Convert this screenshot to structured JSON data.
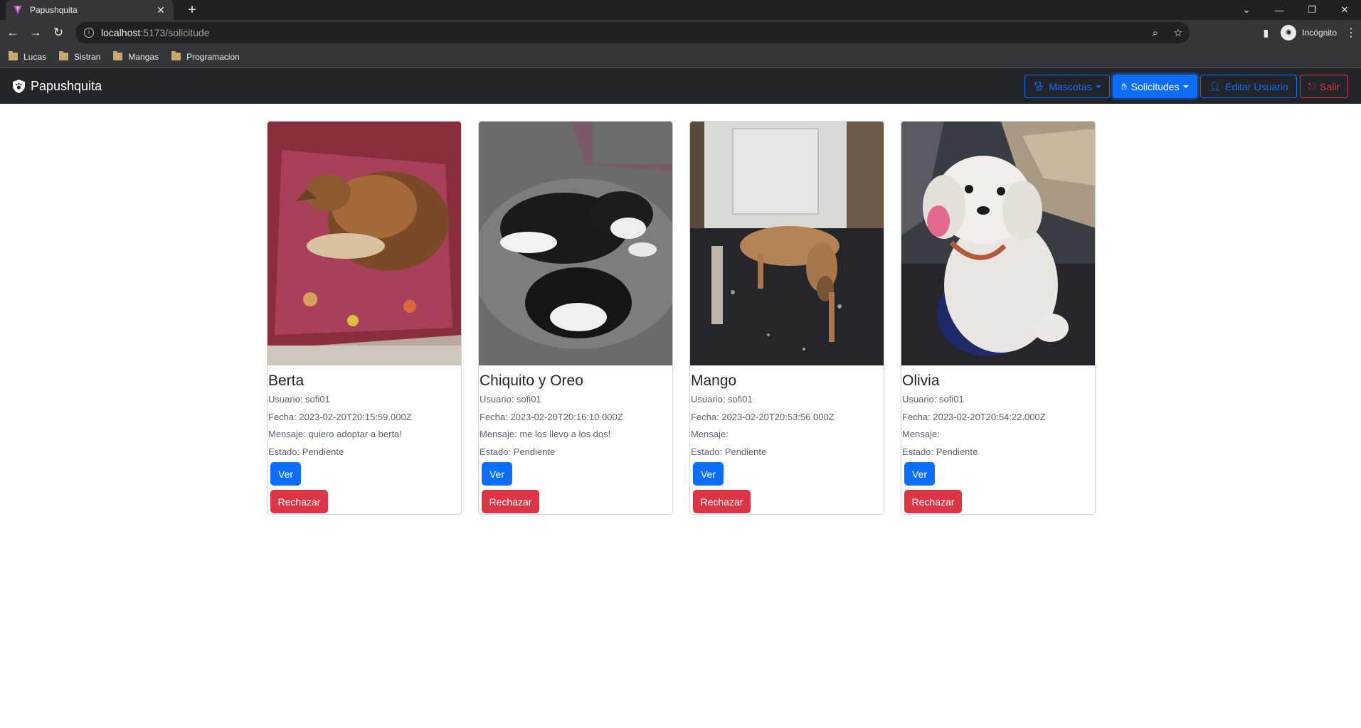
{
  "browser": {
    "tab_title": "Papushquita",
    "url_host": "localhost",
    "url_path": ":5173/solicitude",
    "profile_label": "Incógnito",
    "bookmarks": [
      "Lucas",
      "Sistran",
      "Mangas",
      "Programacion"
    ]
  },
  "navbar": {
    "brand": "Papushquita",
    "mascotas_label": "Mascotas",
    "solicitudes_label": "Solicitudes",
    "editar_label": "Editar Usuario",
    "salir_label": "Salir"
  },
  "cards": [
    {
      "name": "Berta",
      "usuario": "Usuario: sofi01",
      "fecha": "Fecha: 2023-02-20T20:15:59.000Z",
      "mensaje": "Mensaje: quiero adoptar a berta!",
      "estado": "Estado: Pendiente",
      "ver_label": "Ver",
      "rechazar_label": "Rechazar"
    },
    {
      "name": "Chiquito y Oreo",
      "usuario": "Usuario: sofi01",
      "fecha": "Fecha: 2023-02-20T20:16:10.000Z",
      "mensaje": "Mensaje: me los llevo a los dos!",
      "estado": "Estado: Pendiente",
      "ver_label": "Ver",
      "rechazar_label": "Rechazar"
    },
    {
      "name": "Mango",
      "usuario": "Usuario: sofi01",
      "fecha": "Fecha: 2023-02-20T20:53:56.000Z",
      "mensaje": "Mensaje:",
      "estado": "Estado: Pendiente",
      "ver_label": "Ver",
      "rechazar_label": "Rechazar"
    },
    {
      "name": "Olivia",
      "usuario": "Usuario: sofi01",
      "fecha": "Fecha: 2023-02-20T20:54:22.000Z",
      "mensaje": "Mensaje:",
      "estado": "Estado: Pendiente",
      "ver_label": "Ver",
      "rechazar_label": "Rechazar"
    }
  ],
  "colors": {
    "primary": "#0d6efd",
    "danger": "#dc3545",
    "navbar_bg": "#212529"
  }
}
